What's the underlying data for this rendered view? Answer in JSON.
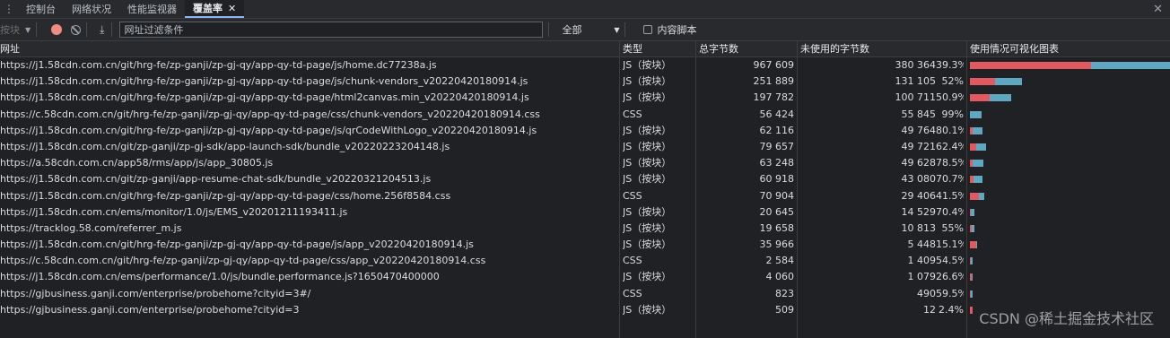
{
  "tabs": [
    {
      "label": "控制台"
    },
    {
      "label": "网络状况"
    },
    {
      "label": "性能监视器"
    },
    {
      "label": "覆盖率"
    }
  ],
  "toolbar": {
    "instrumentation": "按块",
    "filter_placeholder": "网址过滤条件",
    "type_filter": "全部",
    "content_scripts_label": "内容脚本"
  },
  "columns": {
    "url": "网址",
    "type": "类型",
    "total": "总字节数",
    "unused": "未使用的字节数",
    "viz": "使用情况可视化图表"
  },
  "rows": [
    {
      "url": "https://j1.58cdn.com.cn/git/hrg-fe/zp-ganji/zp-gj-qy/app-qy-td-page/js/home.dc77238a.js",
      "type": "JS（按块）",
      "total": "967 609",
      "unused": "380 364",
      "pct": "39.3%",
      "bytes": 967609,
      "unused_ratio": 0.393
    },
    {
      "url": "https://j1.58cdn.com.cn/git/hrg-fe/zp-ganji/zp-gj-qy/app-qy-td-page/js/chunk-vendors_v20220420180914.js",
      "type": "JS（按块）",
      "total": "251 889",
      "unused": "131 105",
      "pct": "52%",
      "bytes": 251889,
      "unused_ratio": 0.52
    },
    {
      "url": "https://j1.58cdn.com.cn/git/hrg-fe/zp-ganji/zp-gj-qy/app-qy-td-page/html2canvas.min_v20220420180914.js",
      "type": "JS（按块）",
      "total": "197 782",
      "unused": "100 711",
      "pct": "50.9%",
      "bytes": 197782,
      "unused_ratio": 0.509
    },
    {
      "url": "https://c.58cdn.com.cn/git/hrg-fe/zp-ganji/zp-gj-qy/app-qy-td-page/css/chunk-vendors_v20220420180914.css",
      "type": "CSS",
      "total": "56 424",
      "unused": "55 845",
      "pct": "99%",
      "bytes": 56424,
      "unused_ratio": 0.99
    },
    {
      "url": "https://j1.58cdn.com.cn/git/hrg-fe/zp-ganji/zp-gj-qy/app-qy-td-page/js/qrCodeWithLogo_v20220420180914.js",
      "type": "JS（按块）",
      "total": "62 116",
      "unused": "49 764",
      "pct": "80.1%",
      "bytes": 62116,
      "unused_ratio": 0.801
    },
    {
      "url": "https://j1.58cdn.com.cn/git/zp-ganji/zp-gj-sdk/app-launch-sdk/bundle_v20220223204148.js",
      "type": "JS（按块）",
      "total": "79 657",
      "unused": "49 721",
      "pct": "62.4%",
      "bytes": 79657,
      "unused_ratio": 0.624
    },
    {
      "url": "https://a.58cdn.com.cn/app58/rms/app/js/app_30805.js",
      "type": "JS（按块）",
      "total": "63 248",
      "unused": "49 628",
      "pct": "78.5%",
      "bytes": 63248,
      "unused_ratio": 0.785
    },
    {
      "url": "https://j1.58cdn.com.cn/git/zp-ganji/app-resume-chat-sdk/bundle_v20220321204513.js",
      "type": "JS（按块）",
      "total": "60 918",
      "unused": "43 080",
      "pct": "70.7%",
      "bytes": 60918,
      "unused_ratio": 0.707
    },
    {
      "url": "https://j1.58cdn.com.cn/git/hrg-fe/zp-ganji/zp-gj-qy/app-qy-td-page/css/home.256f8584.css",
      "type": "CSS",
      "total": "70 904",
      "unused": "29 406",
      "pct": "41.5%",
      "bytes": 70904,
      "unused_ratio": 0.415
    },
    {
      "url": "https://j1.58cdn.com.cn/ems/monitor/1.0/js/EMS_v20201211193411.js",
      "type": "JS（按块）",
      "total": "20 645",
      "unused": "14 529",
      "pct": "70.4%",
      "bytes": 20645,
      "unused_ratio": 0.704
    },
    {
      "url": "https://tracklog.58.com/referrer_m.js",
      "type": "JS（按块）",
      "total": "19 658",
      "unused": "10 813",
      "pct": "55%",
      "bytes": 19658,
      "unused_ratio": 0.55
    },
    {
      "url": "https://j1.58cdn.com.cn/git/hrg-fe/zp-ganji/zp-gj-qy/app-qy-td-page/js/app_v20220420180914.js",
      "type": "JS（按块）",
      "total": "35 966",
      "unused": "5 448",
      "pct": "15.1%",
      "bytes": 35966,
      "unused_ratio": 0.151
    },
    {
      "url": "https://c.58cdn.com.cn/git/hrg-fe/zp-ganji/zp-gj-qy/app-qy-td-page/css/app_v20220420180914.css",
      "type": "CSS",
      "total": "2 584",
      "unused": "1 409",
      "pct": "54.5%",
      "bytes": 2584,
      "unused_ratio": 0.545
    },
    {
      "url": "https://j1.58cdn.com.cn/ems/performance/1.0/js/bundle.performance.js?1650470400000",
      "type": "JS（按块）",
      "total": "4 060",
      "unused": "1 079",
      "pct": "26.6%",
      "bytes": 4060,
      "unused_ratio": 0.266
    },
    {
      "url": "https://gjbusiness.ganji.com/enterprise/probehome?cityid=3#/",
      "type": "CSS",
      "total": "823",
      "unused": "490",
      "pct": "59.5%",
      "bytes": 823,
      "unused_ratio": 0.595
    },
    {
      "url": "https://gjbusiness.ganji.com/enterprise/probehome?cityid=3",
      "type": "JS（按块）",
      "total": "509",
      "unused": "12",
      "pct": "2.4%",
      "bytes": 509,
      "unused_ratio": 0.024
    }
  ],
  "watermark": "CSDN @稀土掘金技术社区"
}
